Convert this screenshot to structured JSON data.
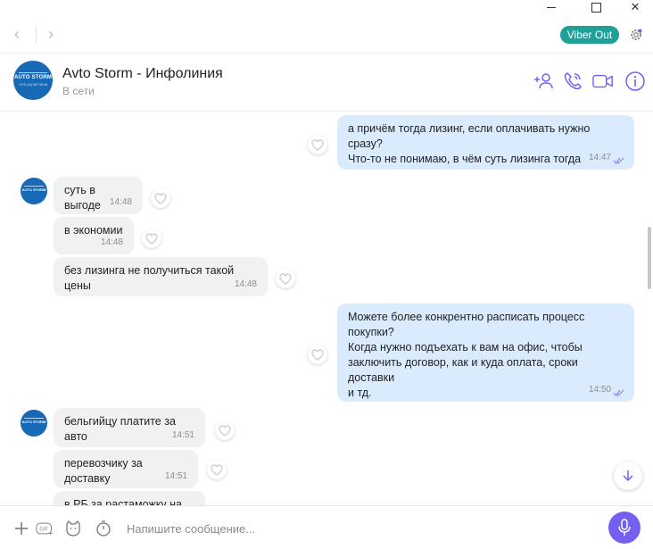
{
  "window": {
    "minimize_icon": "minimize-icon",
    "maximize_icon": "maximize-icon",
    "close_glyph": "✕"
  },
  "nav": {
    "back_glyph": "‹",
    "forward_glyph": "›",
    "viber_out_label": "Viber Out"
  },
  "chat": {
    "title": "Avto Storm - Инфолиния",
    "status": "В сети",
    "avatar_text": "AUTO STORM",
    "avatar_phone": "+375 (44) 557-98-98"
  },
  "messages": [
    {
      "dir": "out",
      "text": "а причём тогда лизинг, если оплачивать нужно сразу?\nЧто-то не понимаю, в чём суть лизинга тогда",
      "time": "14:47",
      "read": true
    },
    {
      "dir": "in",
      "text": "суть в выгоде",
      "time": "14:48",
      "avatar": true
    },
    {
      "dir": "in",
      "text": "в экономии",
      "time": "14:48"
    },
    {
      "dir": "in",
      "text": "без лизинга не получиться такой цены",
      "time": "14:48"
    },
    {
      "dir": "out",
      "text": "Можете более конкрентно расписать процесс\nпокупки?\nКогда нужно подъехать к вам на офис, чтобы\nзаключить договор, как и куда оплата, сроки доставки\nи тд.",
      "time": "14:50",
      "read": true
    },
    {
      "dir": "in",
      "text": "бельгийцу платите за авто",
      "time": "14:51",
      "avatar": true
    },
    {
      "dir": "in",
      "text": "перевозчику за доставку",
      "time": "14:51"
    },
    {
      "dir": "in",
      "text": "в РБ за растаможку на свх",
      "time": ""
    }
  ],
  "composer": {
    "placeholder": "Напишите сообщение...",
    "gif_label": "GIF"
  },
  "colors": {
    "accent": "#7360f2",
    "viber_out": "#1da199",
    "outgoing_bubble": "#d9ebfd",
    "incoming_bubble": "#f1f0f3"
  }
}
